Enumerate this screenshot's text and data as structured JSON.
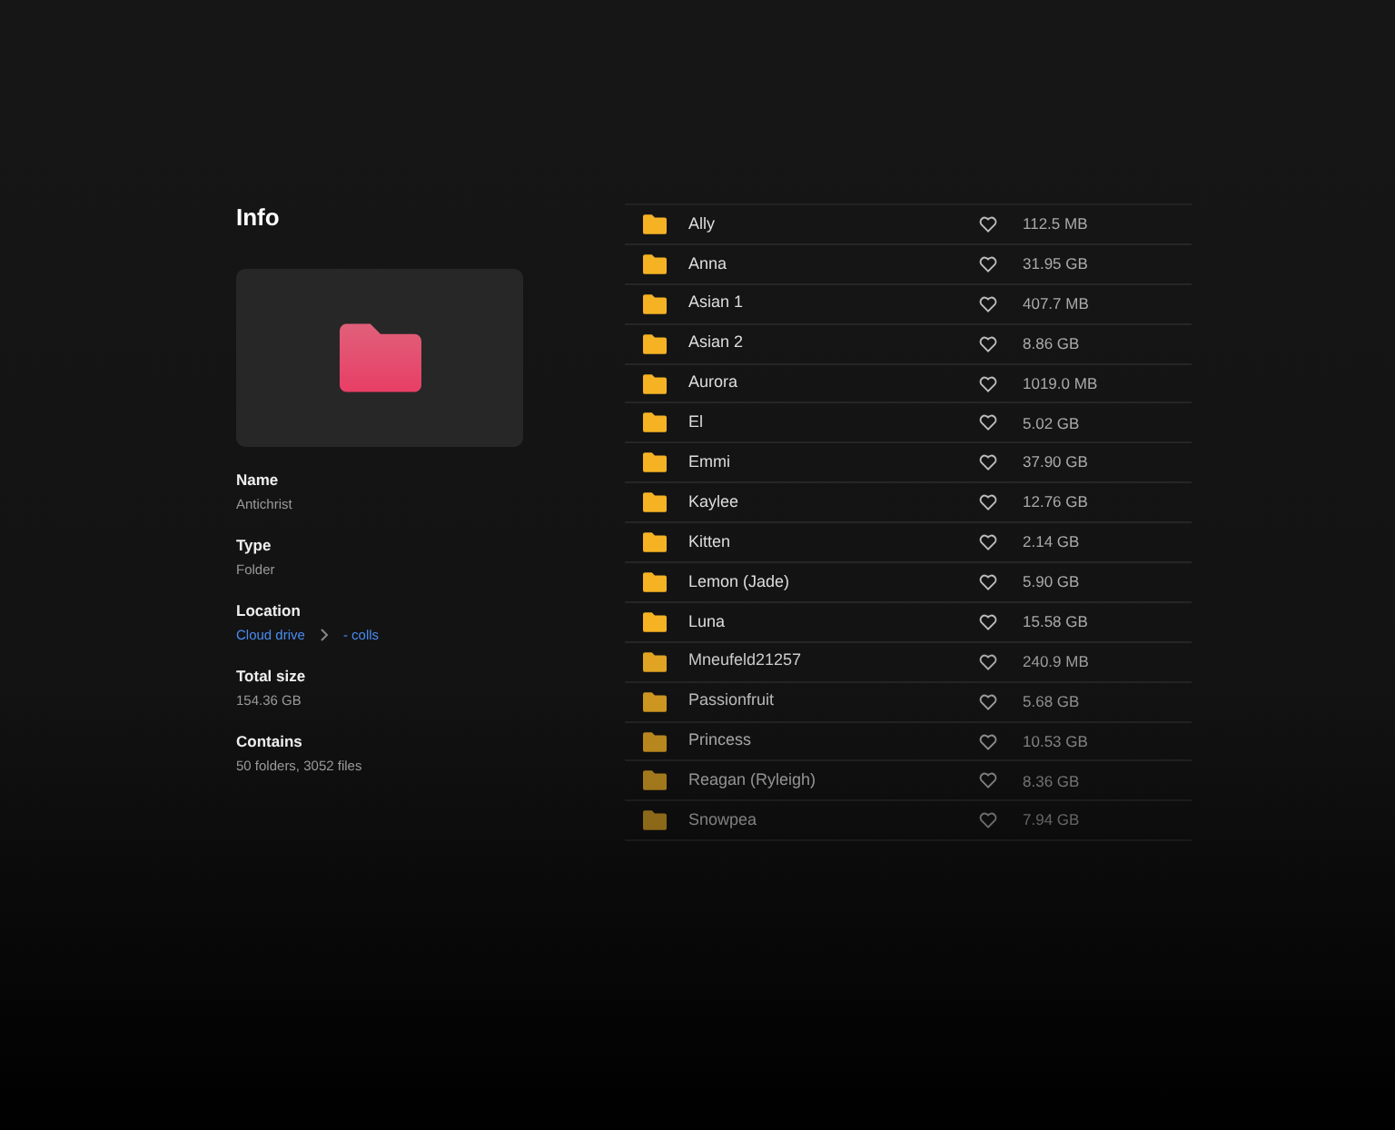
{
  "info": {
    "title": "Info",
    "fields": [
      {
        "label": "Name",
        "value": "Antichrist",
        "kind": "text"
      },
      {
        "label": "Type",
        "value": "Folder",
        "kind": "text"
      },
      {
        "label": "Location",
        "kind": "path",
        "parts": [
          "Cloud drive",
          "- colls"
        ]
      },
      {
        "label": "Total size",
        "value": "154.36 GB",
        "kind": "text"
      },
      {
        "label": "Contains",
        "value": "50 folders, 3052 files",
        "kind": "text"
      }
    ]
  },
  "files": [
    {
      "name": "Ally",
      "size": "112.5 MB",
      "favorite": false
    },
    {
      "name": "Anna",
      "size": "31.95 GB",
      "favorite": false
    },
    {
      "name": "Asian 1",
      "size": "407.7 MB",
      "favorite": false
    },
    {
      "name": "Asian 2",
      "size": "8.86 GB",
      "favorite": false
    },
    {
      "name": "Aurora",
      "size": "1019.0 MB",
      "favorite": false
    },
    {
      "name": "El",
      "size": "5.02 GB",
      "favorite": false
    },
    {
      "name": "Emmi",
      "size": "37.90 GB",
      "favorite": false
    },
    {
      "name": "Kaylee",
      "size": "12.76 GB",
      "favorite": false
    },
    {
      "name": "Kitten",
      "size": "2.14 GB",
      "favorite": false
    },
    {
      "name": "Lemon (Jade)",
      "size": "5.90 GB",
      "favorite": false
    },
    {
      "name": "Luna",
      "size": "15.58 GB",
      "favorite": false
    },
    {
      "name": "Mneufeld21257",
      "size": "240.9 MB",
      "favorite": false
    },
    {
      "name": "Passionfruit",
      "size": "5.68 GB",
      "favorite": false
    },
    {
      "name": "Princess",
      "size": "10.53 GB",
      "favorite": false
    },
    {
      "name": "Reagan (Ryleigh)",
      "size": "8.36 GB",
      "favorite": false
    },
    {
      "name": "Snowpea",
      "size": "7.94 GB",
      "favorite": false
    }
  ]
}
